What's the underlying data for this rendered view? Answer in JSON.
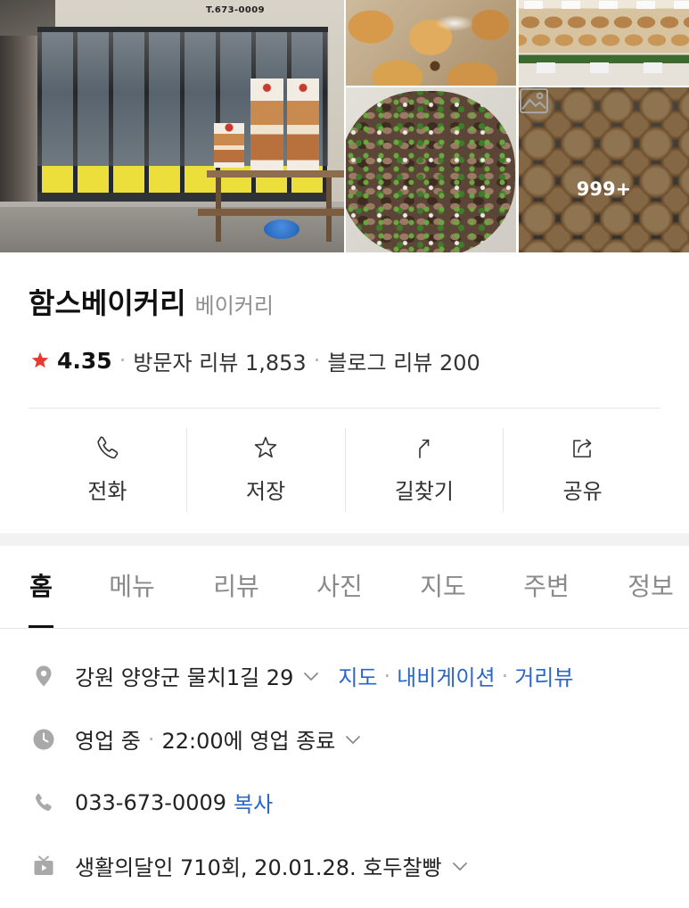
{
  "gallery": {
    "storefront_sign": "T.673-0009",
    "more_photos_count": "999+"
  },
  "place": {
    "name": "함스베이커리",
    "category": "베이커리",
    "rating": "4.35",
    "visitor_reviews": "방문자 리뷰 1,853",
    "blog_reviews": "블로그 리뷰 200"
  },
  "ui": {
    "separator": "·"
  },
  "actions": [
    {
      "label": "전화",
      "icon": "phone-icon"
    },
    {
      "label": "저장",
      "icon": "star-outline-icon"
    },
    {
      "label": "길찾기",
      "icon": "directions-icon"
    },
    {
      "label": "공유",
      "icon": "share-icon"
    }
  ],
  "tabs": [
    {
      "label": "홈",
      "active": true
    },
    {
      "label": "메뉴",
      "active": false
    },
    {
      "label": "리뷰",
      "active": false
    },
    {
      "label": "사진",
      "active": false
    },
    {
      "label": "지도",
      "active": false
    },
    {
      "label": "주변",
      "active": false
    },
    {
      "label": "정보",
      "active": false
    }
  ],
  "info": {
    "address": {
      "icon": "location-pin-icon",
      "text": "강원 양양군 물치1길 29",
      "links": [
        "지도",
        "내비게이션",
        "거리뷰"
      ]
    },
    "hours": {
      "icon": "clock-icon",
      "status": "영업 중",
      "detail": "22:00에 영업 종료"
    },
    "phone": {
      "icon": "phone-icon",
      "number": "033-673-0009",
      "copy_label": "복사"
    },
    "tv": {
      "icon": "tv-icon",
      "text": "생활의달인 710회, 20.01.28. 호두찰빵"
    }
  },
  "colors": {
    "text": "#222222",
    "muted": "#8e8e8e",
    "link": "#2a66c8",
    "rating_star": "#e8392f",
    "info_icon": "#a9a9a9",
    "divider": "#e6e6e6",
    "section_band": "#f2f2f2"
  }
}
